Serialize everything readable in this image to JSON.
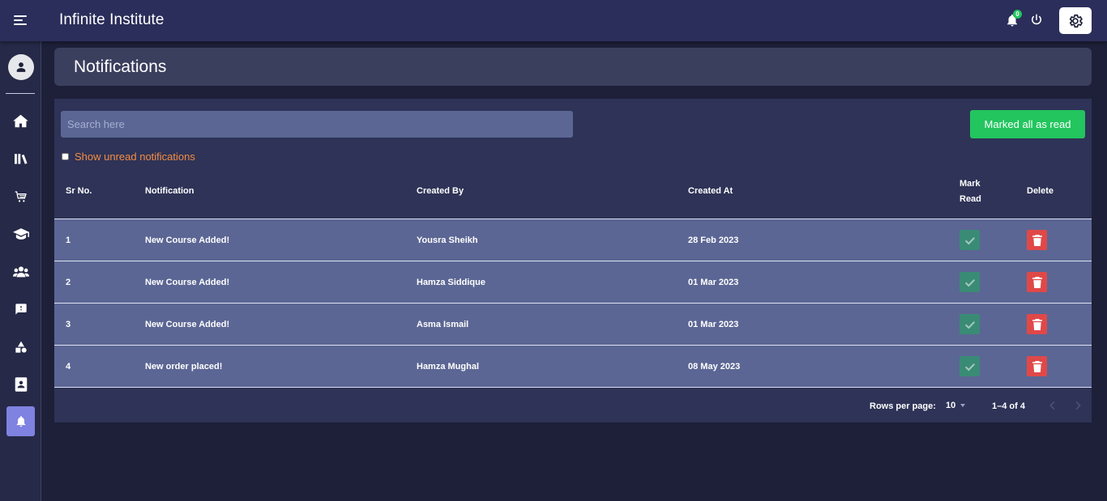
{
  "app": {
    "title": "Infinite Institute",
    "notification_count": "0"
  },
  "header": {
    "hamburger_icon": "menu-icon",
    "bell_icon": "bell-icon",
    "power_icon": "power-icon",
    "settings_icon": "gear-icon"
  },
  "sidebar": {
    "avatar_icon": "user-icon",
    "items": [
      {
        "icon": "home-icon"
      },
      {
        "icon": "library-icon"
      },
      {
        "icon": "cart-icon"
      },
      {
        "icon": "graduation-cap-icon"
      },
      {
        "icon": "users-icon"
      },
      {
        "icon": "feedback-icon"
      },
      {
        "icon": "shapes-icon"
      },
      {
        "icon": "contacts-icon"
      },
      {
        "icon": "bell-icon",
        "active": true
      }
    ]
  },
  "page": {
    "title": "Notifications"
  },
  "controls": {
    "search_placeholder": "Search here",
    "mark_all_label": "Marked all as read",
    "unread_label": "Show unread notifications",
    "unread_checked": false
  },
  "table": {
    "columns": {
      "sr": "Sr No.",
      "notification": "Notification",
      "created_by": "Created By",
      "created_at": "Created At",
      "mark_read_line1": "Mark",
      "mark_read_line2": "Read",
      "delete": "Delete"
    },
    "rows": [
      {
        "sr": "1",
        "notification": "New Course Added!",
        "created_by": "Yousra Sheikh",
        "created_at": "28 Feb 2023"
      },
      {
        "sr": "2",
        "notification": "New Course Added!",
        "created_by": "Hamza Siddique",
        "created_at": "01 Mar 2023"
      },
      {
        "sr": "3",
        "notification": "New Course Added!",
        "created_by": "Asma Ismail",
        "created_at": "01 Mar 2023"
      },
      {
        "sr": "4",
        "notification": "New order placed!",
        "created_by": "Hamza Mughal",
        "created_at": "08 May 2023"
      }
    ]
  },
  "pagination": {
    "rows_per_page_label": "Rows per page:",
    "rows_per_page": "10",
    "range": "1–4 of 4"
  },
  "colors": {
    "topbar": "#2b2e5a",
    "row": "#5b6694",
    "accent_green": "#22c55e",
    "danger": "#e04848",
    "mark_read": "#3a8b75",
    "active_nav": "#7f82e0",
    "warning_text": "#f58c43"
  }
}
